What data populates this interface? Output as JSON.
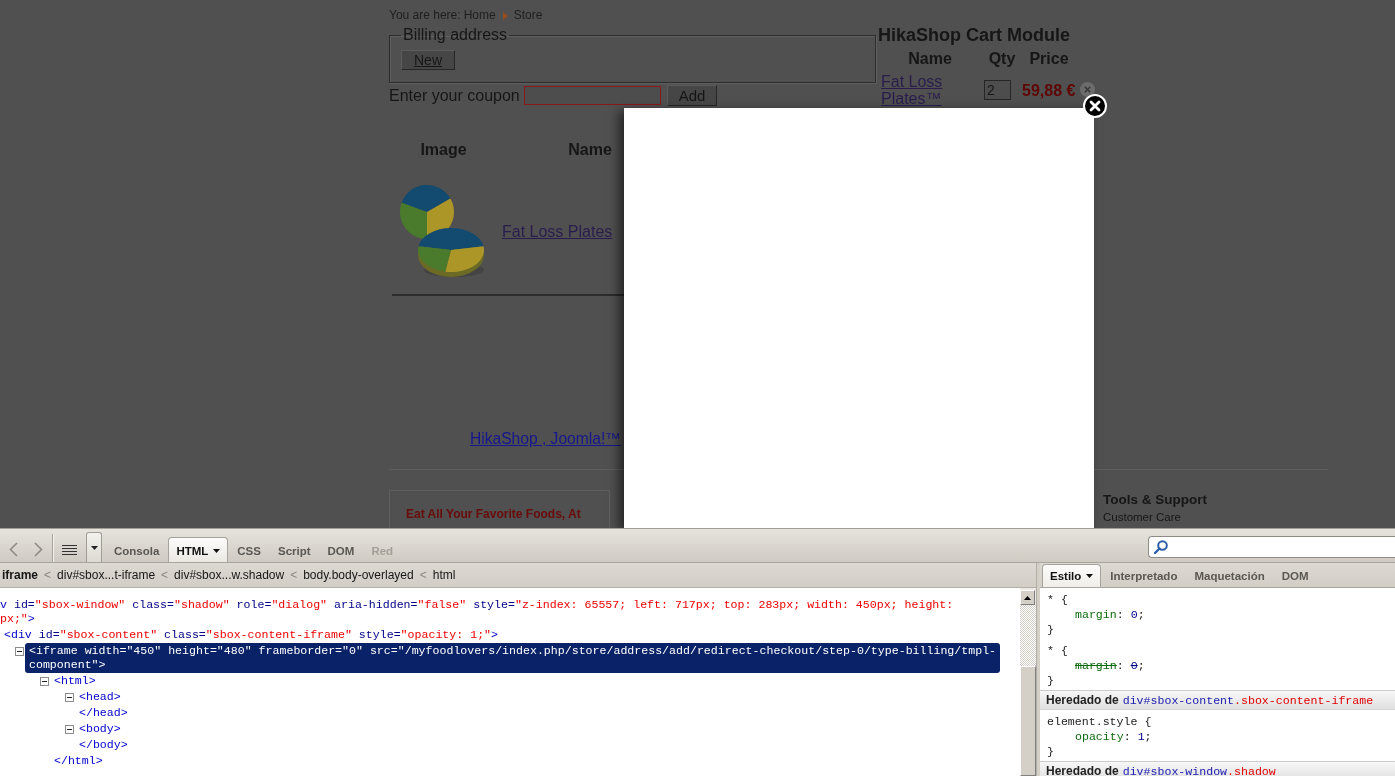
{
  "page": {
    "breadcrumb": {
      "prefix": "You are here:",
      "items": [
        {
          "label": "Home"
        },
        {
          "label": "Store"
        }
      ]
    },
    "billing": {
      "legend": "Billing address",
      "button": "New"
    },
    "coupon": {
      "label": "Enter your coupon",
      "button": "Add"
    },
    "products": {
      "columns": [
        "Image",
        "Name"
      ],
      "rows": [
        {
          "name": "Fat Loss Plates"
        }
      ]
    },
    "footer_link": "HikaShop , Joomla!™",
    "promo": "Eat All Your Favorite Foods, At",
    "support": {
      "title": "Tools & Support",
      "links": [
        "Customer Care"
      ]
    }
  },
  "cart_module": {
    "title": "HikaShop Cart Module",
    "columns": [
      "Name",
      "Qty",
      "Price"
    ],
    "rows": [
      {
        "name": "Fat Loss Plates™",
        "qty": "2",
        "price": "59,88 €"
      }
    ]
  },
  "devtools": {
    "tabs": [
      {
        "label": "Consola",
        "selected": false,
        "disabled": false,
        "has_menu": false
      },
      {
        "label": "HTML",
        "selected": true,
        "disabled": false,
        "has_menu": true
      },
      {
        "label": "CSS",
        "selected": false,
        "disabled": false,
        "has_menu": false
      },
      {
        "label": "Script",
        "selected": false,
        "disabled": false,
        "has_menu": false
      },
      {
        "label": "DOM",
        "selected": false,
        "disabled": false,
        "has_menu": false
      },
      {
        "label": "Red",
        "selected": false,
        "disabled": true,
        "has_menu": false
      }
    ],
    "node_path": [
      {
        "label": "iframe",
        "selected": true
      },
      {
        "separator": "<",
        "label": "div#sbox...t-iframe",
        "selected": false
      },
      {
        "separator": "<",
        "label": "div#sbox...w.shadow",
        "selected": false
      },
      {
        "separator": "<",
        "label": "body.body-overlayed",
        "selected": false
      },
      {
        "separator": "<",
        "label": "html",
        "selected": false
      }
    ],
    "tree": [
      {
        "selected": false,
        "open": [
          [
            {
              "kind": "tag",
              "text": "v"
            },
            {
              "kind": "attr",
              "text": " id="
            },
            {
              "kind": "value",
              "text": "\"sbox-window\""
            },
            {
              "kind": "attr",
              "text": " class="
            },
            {
              "kind": "value",
              "text": "\"shadow\""
            },
            {
              "kind": "attr",
              "text": " role="
            },
            {
              "kind": "value",
              "text": "\"dialog\""
            },
            {
              "kind": "attr",
              "text": " aria-hidden="
            },
            {
              "kind": "value",
              "text": "\"false\""
            },
            {
              "kind": "attr",
              "text": " style="
            },
            {
              "kind": "value",
              "text": "\"z-index: 65557; left: 717px; top: 283px; width: 450px; height:"
            }
          ],
          [
            {
              "kind": "value",
              "text": "px;\""
            },
            {
              "kind": "tag",
              "text": ">"
            }
          ]
        ],
        "children": [
          {
            "selected": false,
            "open": [
              [
                {
                  "kind": "tag",
                  "text": "<div"
                },
                {
                  "kind": "attr",
                  "text": " id="
                },
                {
                  "kind": "value",
                  "text": "\"sbox-content\""
                },
                {
                  "kind": "attr",
                  "text": " class="
                },
                {
                  "kind": "value",
                  "text": "\"sbox-content-iframe\""
                },
                {
                  "kind": "attr",
                  "text": " style="
                },
                {
                  "kind": "value",
                  "text": "\"opacity: 1;\""
                },
                {
                  "kind": "tag",
                  "text": ">"
                }
              ]
            ],
            "children": [
              {
                "selected": true,
                "expanded": true,
                "open": [
                  "<iframe width=\"450\" height=\"480\" frameborder=\"0\" src=\"/myfoodlovers/index.php/store/address/add/redirect-checkout/step-0/type-billing/tmpl-",
                  "component\">"
                ],
                "children": [
                  {
                    "selected": false,
                    "expanded": true,
                    "open": [
                      [
                        {
                          "kind": "tag",
                          "text": "<html>"
                        }
                      ]
                    ],
                    "children": [
                      {
                        "selected": false,
                        "expanded": true,
                        "open": [
                          [
                            {
                              "kind": "tag",
                              "text": "<head>"
                            }
                          ]
                        ],
                        "close": [
                          {
                            "kind": "tag",
                            "text": "</head>"
                          }
                        ]
                      },
                      {
                        "selected": false,
                        "expanded": true,
                        "open": [
                          [
                            {
                              "kind": "tag",
                              "text": "<body>"
                            }
                          ]
                        ],
                        "close": [
                          {
                            "kind": "tag",
                            "text": "</body>"
                          }
                        ]
                      }
                    ],
                    "close": [
                      {
                        "kind": "tag",
                        "text": "</html>"
                      }
                    ]
                  }
                ]
              }
            ]
          }
        ]
      }
    ],
    "side_tabs": [
      {
        "label": "Estilo",
        "selected": true,
        "has_menu": true
      },
      {
        "label": "Interpretado",
        "selected": false,
        "has_menu": false
      },
      {
        "label": "Maquetación",
        "selected": false,
        "has_menu": false
      },
      {
        "label": "DOM",
        "selected": false,
        "has_menu": false
      }
    ],
    "style_blocks": [
      {
        "kind": "rule",
        "head": "* {",
        "declarations": [
          {
            "property": "margin",
            "sep": ": ",
            "value": "0",
            "end": ";",
            "overridden": false
          }
        ],
        "tail": "}"
      },
      {
        "kind": "rule",
        "head": "* {",
        "declarations": [
          {
            "property": "margin",
            "sep": ": ",
            "value": "0",
            "end": ";",
            "overridden": true
          }
        ],
        "tail": "}"
      },
      {
        "kind": "inherited",
        "label": "Heredado de",
        "element": "div#sbox-content",
        "classes": ".sbox-content-iframe"
      },
      {
        "kind": "rule",
        "head": "element.style {",
        "declarations": [
          {
            "property": "opacity",
            "sep": ": ",
            "value": "1",
            "end": ";",
            "overridden": false
          }
        ],
        "tail": "}"
      },
      {
        "kind": "inherited",
        "label": "Heredado de",
        "element": "div#sbox-window",
        "classes": ".shadow"
      }
    ]
  }
}
